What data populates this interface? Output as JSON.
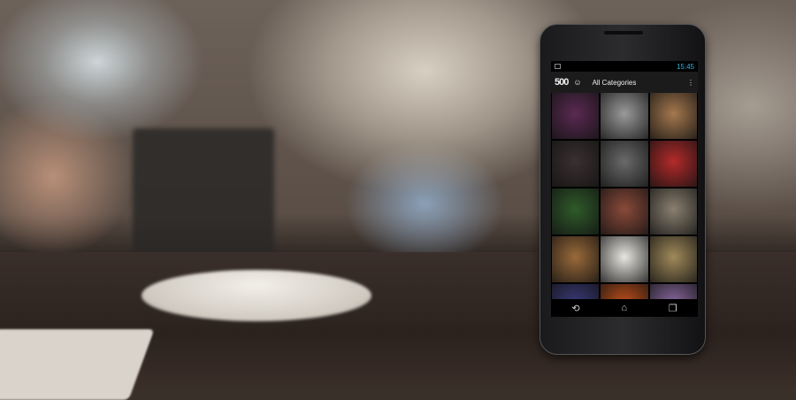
{
  "status_bar": {
    "time": "15:45"
  },
  "action_bar": {
    "logo": "500",
    "category": "All Categories",
    "menu_icon": "overflow-menu-icon"
  },
  "photos": [
    {
      "color": "#5a2a52"
    },
    {
      "color": "#9a9a9a"
    },
    {
      "color": "#a5784e"
    },
    {
      "color": "#3a3030"
    },
    {
      "color": "#6a6a6a"
    },
    {
      "color": "#b32a2a"
    },
    {
      "color": "#2f5a2a"
    },
    {
      "color": "#8a4a3a"
    },
    {
      "color": "#8a8070"
    },
    {
      "color": "#9a6a3a"
    },
    {
      "color": "#e8e6e0"
    },
    {
      "color": "#a08a5a"
    },
    {
      "color": "#3a3a7a"
    },
    {
      "color": "#c0501a"
    },
    {
      "color": "#8a6aa0"
    }
  ],
  "nav": {
    "back": "back-icon",
    "home": "home-icon",
    "recents": "recents-icon"
  }
}
